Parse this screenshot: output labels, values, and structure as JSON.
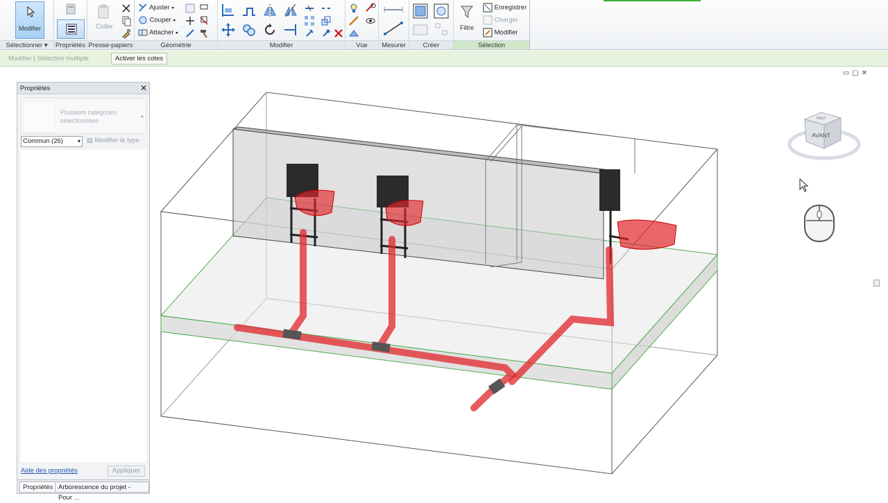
{
  "ribbon": {
    "select": {
      "modify_label": "Modifier",
      "group_label": "Sélectionner ▾"
    },
    "properties": {
      "label": "Propriétés",
      "group_label": "Propriétés"
    },
    "clipboard": {
      "paste_label": "Coller",
      "group_label": "Presse-papiers"
    },
    "geometry": {
      "trim_label": "Ajuster",
      "cut_label": "Couper",
      "join_label": "Attacher",
      "group_label": "Géométrie"
    },
    "modify": {
      "group_label": "Modifier"
    },
    "view": {
      "group_label": "Vue"
    },
    "measure": {
      "group_label": "Mesurer"
    },
    "create": {
      "group_label": "Créer"
    },
    "selection": {
      "filter_label": "Filtre",
      "save_label": "Enregistrer",
      "load_label": "Charger",
      "edit_label": "Modifier",
      "group_label": "Sélection"
    }
  },
  "context_bar": {
    "mode_text": "Modifier | Sélection multiple",
    "activate_dims_label": "Activer les cotes"
  },
  "properties_panel": {
    "title": "Propriétés",
    "type_name": "Plusieurs catégories sélectionnées",
    "filter_value": "Commun (26)",
    "edit_type_label": "Modifier le type",
    "help_link": "Aide des propriétés",
    "apply_label": "Appliquer",
    "tabs": [
      "Propriétés",
      "Arborescence du projet - Pour ..."
    ]
  },
  "viewcube": {
    "face_label": "AVANT",
    "top_label": "HAUT"
  },
  "colors": {
    "accent_green": "#3fae3a",
    "pipe_red": "#e0262b",
    "selection_blue": "#a8d0f5"
  }
}
